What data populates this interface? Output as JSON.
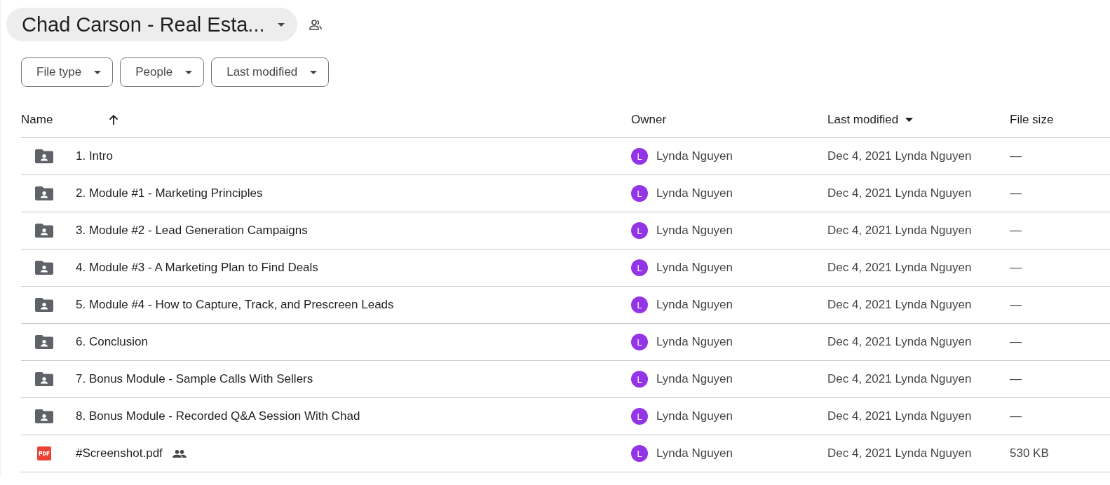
{
  "folder_title": {
    "text": "Chad Carson - Real Esta...",
    "shared": true
  },
  "filters": [
    {
      "label": "File type"
    },
    {
      "label": "People"
    },
    {
      "label": "Last modified"
    }
  ],
  "table": {
    "columns": [
      {
        "kind": "sorted_ascending",
        "label": "Name"
      },
      {
        "kind": "plain",
        "label": "Owner"
      },
      {
        "kind": "sorted_descending",
        "label": "Last modified"
      },
      {
        "kind": "plain",
        "label": "File size"
      }
    ],
    "rows": [
      {
        "kind": "folder",
        "name": "1. Intro",
        "shared": false,
        "owner_initial": "L",
        "owner": "Lynda Nguyen",
        "modified": "Dec 4, 2021 Lynda Nguyen",
        "size": "—"
      },
      {
        "kind": "folder",
        "name": "2. Module #1 - Marketing Principles",
        "shared": false,
        "owner_initial": "L",
        "owner": "Lynda Nguyen",
        "modified": "Dec 4, 2021 Lynda Nguyen",
        "size": "—"
      },
      {
        "kind": "folder",
        "name": "3. Module #2 - Lead Generation Campaigns",
        "shared": false,
        "owner_initial": "L",
        "owner": "Lynda Nguyen",
        "modified": "Dec 4, 2021 Lynda Nguyen",
        "size": "—"
      },
      {
        "kind": "folder",
        "name": "4. Module #3 - A Marketing Plan to Find Deals",
        "shared": false,
        "owner_initial": "L",
        "owner": "Lynda Nguyen",
        "modified": "Dec 4, 2021 Lynda Nguyen",
        "size": "—"
      },
      {
        "kind": "folder",
        "name": "5. Module #4 - How to Capture, Track, and Prescreen Leads",
        "shared": false,
        "owner_initial": "L",
        "owner": "Lynda Nguyen",
        "modified": "Dec 4, 2021 Lynda Nguyen",
        "size": "—"
      },
      {
        "kind": "folder",
        "name": "6. Conclusion",
        "shared": false,
        "owner_initial": "L",
        "owner": "Lynda Nguyen",
        "modified": "Dec 4, 2021 Lynda Nguyen",
        "size": "—"
      },
      {
        "kind": "folder",
        "name": "7. Bonus Module - Sample Calls With Sellers",
        "shared": false,
        "owner_initial": "L",
        "owner": "Lynda Nguyen",
        "modified": "Dec 4, 2021 Lynda Nguyen",
        "size": "—"
      },
      {
        "kind": "folder",
        "name": "8. Bonus Module - Recorded Q&A Session With Chad",
        "shared": false,
        "owner_initial": "L",
        "owner": "Lynda Nguyen",
        "modified": "Dec 4, 2021 Lynda Nguyen",
        "size": "—"
      },
      {
        "kind": "pdf",
        "name": "#Screenshot.pdf",
        "shared": true,
        "owner_initial": "L",
        "owner": "Lynda Nguyen",
        "modified": "Dec 4, 2021 Lynda Nguyen",
        "size": "530 KB"
      }
    ]
  }
}
